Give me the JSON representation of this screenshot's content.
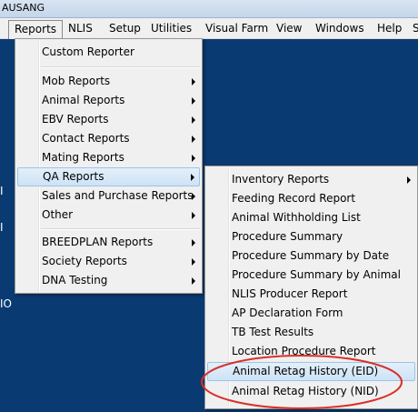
{
  "window": {
    "title": "AUSANG"
  },
  "menubar": {
    "items": [
      "Reports",
      "NLIS",
      "Setup",
      "Utilities",
      "Visual Farm",
      "View",
      "Windows",
      "Help",
      "S"
    ]
  },
  "background_fragments": [
    "I",
    "I",
    "IO"
  ],
  "reports_menu": {
    "items": [
      {
        "label": "Custom Reporter"
      },
      {
        "label": "Mob Reports"
      },
      {
        "label": "Animal Reports"
      },
      {
        "label": "EBV Reports"
      },
      {
        "label": "Contact Reports"
      },
      {
        "label": "Mating Reports"
      },
      {
        "label": "QA Reports"
      },
      {
        "label": "Sales and Purchase Reports"
      },
      {
        "label": "Other"
      },
      {
        "label": "BREEDPLAN Reports"
      },
      {
        "label": "Society Reports"
      },
      {
        "label": "DNA Testing"
      }
    ]
  },
  "qa_submenu": {
    "items": [
      {
        "label": "Inventory Reports"
      },
      {
        "label": "Feeding Record Report"
      },
      {
        "label": "Animal Withholding List"
      },
      {
        "label": "Procedure Summary"
      },
      {
        "label": "Procedure Summary by Date"
      },
      {
        "label": "Procedure Summary by Animal"
      },
      {
        "label": "NLIS Producer Report"
      },
      {
        "label": "AP Declaration Form"
      },
      {
        "label": "TB Test Results"
      },
      {
        "label": "Location Procedure Report"
      },
      {
        "label": "Animal Retag History (EID)"
      },
      {
        "label": "Animal Retag History (NID)"
      }
    ]
  },
  "colors": {
    "desktop_bg": "#0a3a72",
    "menu_bg": "#f0f0f0",
    "highlight": "#cde3f6",
    "annotation_ellipse": "#d9302a"
  }
}
